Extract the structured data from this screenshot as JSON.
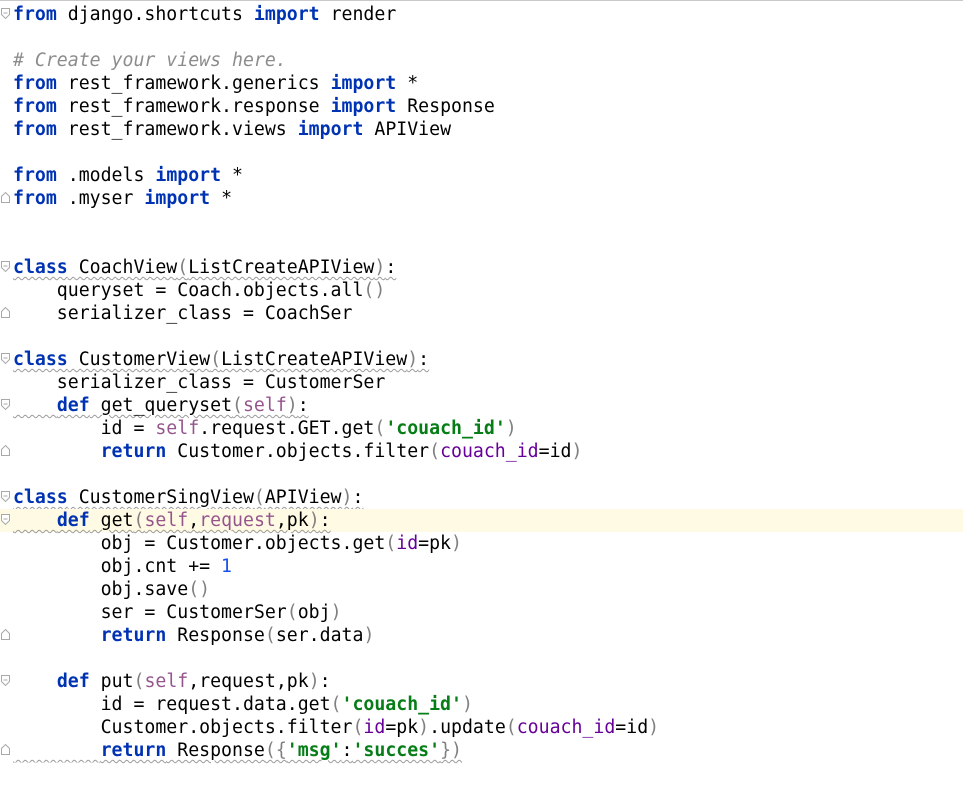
{
  "editor": {
    "language": "python",
    "colors": {
      "keyword": "#0033b3",
      "comment": "#8c8c8c",
      "self": "#94558d",
      "string": "#067d17",
      "number": "#1750eb",
      "kwarg": "#660099",
      "current_line": "#fffae3"
    },
    "lines": [
      [
        [
          "kw",
          "from"
        ],
        [
          "",
          " django.shortcuts "
        ],
        [
          "kw",
          "import"
        ],
        [
          "",
          " render"
        ]
      ],
      [],
      [
        [
          "cm",
          "# Create your views here."
        ]
      ],
      [
        [
          "kw",
          "from"
        ],
        [
          "",
          " rest_framework.generics "
        ],
        [
          "kw",
          "import"
        ],
        [
          "",
          " *"
        ]
      ],
      [
        [
          "kw",
          "from"
        ],
        [
          "",
          " rest_framework.response "
        ],
        [
          "kw",
          "import"
        ],
        [
          "",
          " Response"
        ]
      ],
      [
        [
          "kw",
          "from"
        ],
        [
          "",
          " rest_framework.views "
        ],
        [
          "kw",
          "import"
        ],
        [
          "",
          " APIView"
        ]
      ],
      [],
      [
        [
          "kw",
          "from"
        ],
        [
          "",
          " .models "
        ],
        [
          "kw",
          "import"
        ],
        [
          "",
          " *"
        ]
      ],
      [
        [
          "kw",
          "from"
        ],
        [
          "",
          " .myser "
        ],
        [
          "kw",
          "import"
        ],
        [
          "",
          " *"
        ]
      ],
      [],
      [],
      [
        [
          "kw",
          "class"
        ],
        [
          "",
          " CoachView"
        ],
        [
          "par",
          "("
        ],
        [
          "",
          "ListCreateAPIView"
        ],
        [
          "par",
          ")"
        ],
        [
          "",
          ":"
        ]
      ],
      [
        [
          "",
          "    queryset = Coach.objects.all"
        ],
        [
          "par",
          "()"
        ]
      ],
      [
        [
          "",
          "    serializer_class = CoachSer"
        ]
      ],
      [],
      [
        [
          "kw",
          "class"
        ],
        [
          "",
          " CustomerView"
        ],
        [
          "par",
          "("
        ],
        [
          "",
          "ListCreateAPIView"
        ],
        [
          "par",
          ")"
        ],
        [
          "",
          ":"
        ]
      ],
      [
        [
          "",
          "    serializer_class = CustomerSer"
        ]
      ],
      [
        [
          "",
          "    "
        ],
        [
          "kw",
          "def"
        ],
        [
          "",
          " get_queryset"
        ],
        [
          "par",
          "("
        ],
        [
          "self",
          "self"
        ],
        [
          "par",
          ")"
        ],
        [
          "",
          ":"
        ]
      ],
      [
        [
          "",
          "        id = "
        ],
        [
          "self",
          "self"
        ],
        [
          "",
          ".request.GET.get"
        ],
        [
          "par",
          "("
        ],
        [
          "str",
          "'couach_id'"
        ],
        [
          "par",
          ")"
        ]
      ],
      [
        [
          "",
          "        "
        ],
        [
          "kw",
          "return"
        ],
        [
          "",
          " Customer.objects.filter"
        ],
        [
          "par",
          "("
        ],
        [
          "kwarg",
          "couach_id"
        ],
        [
          "",
          "=id"
        ],
        [
          "par",
          ")"
        ]
      ],
      [],
      [
        [
          "kw",
          "class"
        ],
        [
          "",
          " CustomerSingView"
        ],
        [
          "par",
          "("
        ],
        [
          "",
          "APIView"
        ],
        [
          "par",
          ")"
        ],
        [
          "",
          ":"
        ]
      ],
      [
        [
          "",
          "    "
        ],
        [
          "kw",
          "def"
        ],
        [
          "",
          " get"
        ],
        [
          "par",
          "("
        ],
        [
          "self",
          "self"
        ],
        [
          "",
          ","
        ],
        [
          "self",
          "request"
        ],
        [
          "",
          ",pk"
        ],
        [
          "par",
          ")"
        ],
        [
          "",
          ":"
        ]
      ],
      [
        [
          "",
          "        obj = Customer.objects.get"
        ],
        [
          "par",
          "("
        ],
        [
          "kwarg",
          "id"
        ],
        [
          "",
          "=pk"
        ],
        [
          "par",
          ")"
        ]
      ],
      [
        [
          "",
          "        obj.cnt += "
        ],
        [
          "num",
          "1"
        ]
      ],
      [
        [
          "",
          "        obj.save"
        ],
        [
          "par",
          "()"
        ]
      ],
      [
        [
          "",
          "        ser = CustomerSer"
        ],
        [
          "par",
          "("
        ],
        [
          "",
          "obj"
        ],
        [
          "par",
          ")"
        ]
      ],
      [
        [
          "",
          "        "
        ],
        [
          "kw",
          "return"
        ],
        [
          "",
          " Response"
        ],
        [
          "par",
          "("
        ],
        [
          "",
          "ser.data"
        ],
        [
          "par",
          ")"
        ]
      ],
      [],
      [
        [
          "",
          "    "
        ],
        [
          "kw",
          "def"
        ],
        [
          "",
          " put"
        ],
        [
          "par",
          "("
        ],
        [
          "self",
          "self"
        ],
        [
          "",
          ",request,pk"
        ],
        [
          "par",
          ")"
        ],
        [
          "",
          ":"
        ]
      ],
      [
        [
          "",
          "        id = request.data.get"
        ],
        [
          "par",
          "("
        ],
        [
          "str",
          "'couach_id'"
        ],
        [
          "par",
          ")"
        ]
      ],
      [
        [
          "",
          "        Customer.objects.filter"
        ],
        [
          "par",
          "("
        ],
        [
          "kwarg",
          "id"
        ],
        [
          "",
          "=pk"
        ],
        [
          "par",
          ")"
        ],
        [
          "",
          ".update"
        ],
        [
          "par",
          "("
        ],
        [
          "kwarg",
          "couach_id"
        ],
        [
          "",
          "=id"
        ],
        [
          "par",
          ")"
        ]
      ],
      [
        [
          "",
          "        "
        ],
        [
          "kw",
          "return"
        ],
        [
          "",
          " Response"
        ],
        [
          "par",
          "({"
        ],
        [
          "str",
          "'msg'"
        ],
        [
          "",
          ":"
        ],
        [
          "str",
          "'succes'"
        ],
        [
          "par",
          "})"
        ]
      ]
    ],
    "current_line": 22,
    "fold_open_lines": [
      0,
      11,
      15,
      17,
      21,
      22,
      29
    ],
    "fold_close_lines": [
      8,
      13,
      19,
      27,
      32
    ],
    "wavy_lines": [
      11,
      15,
      17,
      21,
      22,
      32
    ]
  }
}
